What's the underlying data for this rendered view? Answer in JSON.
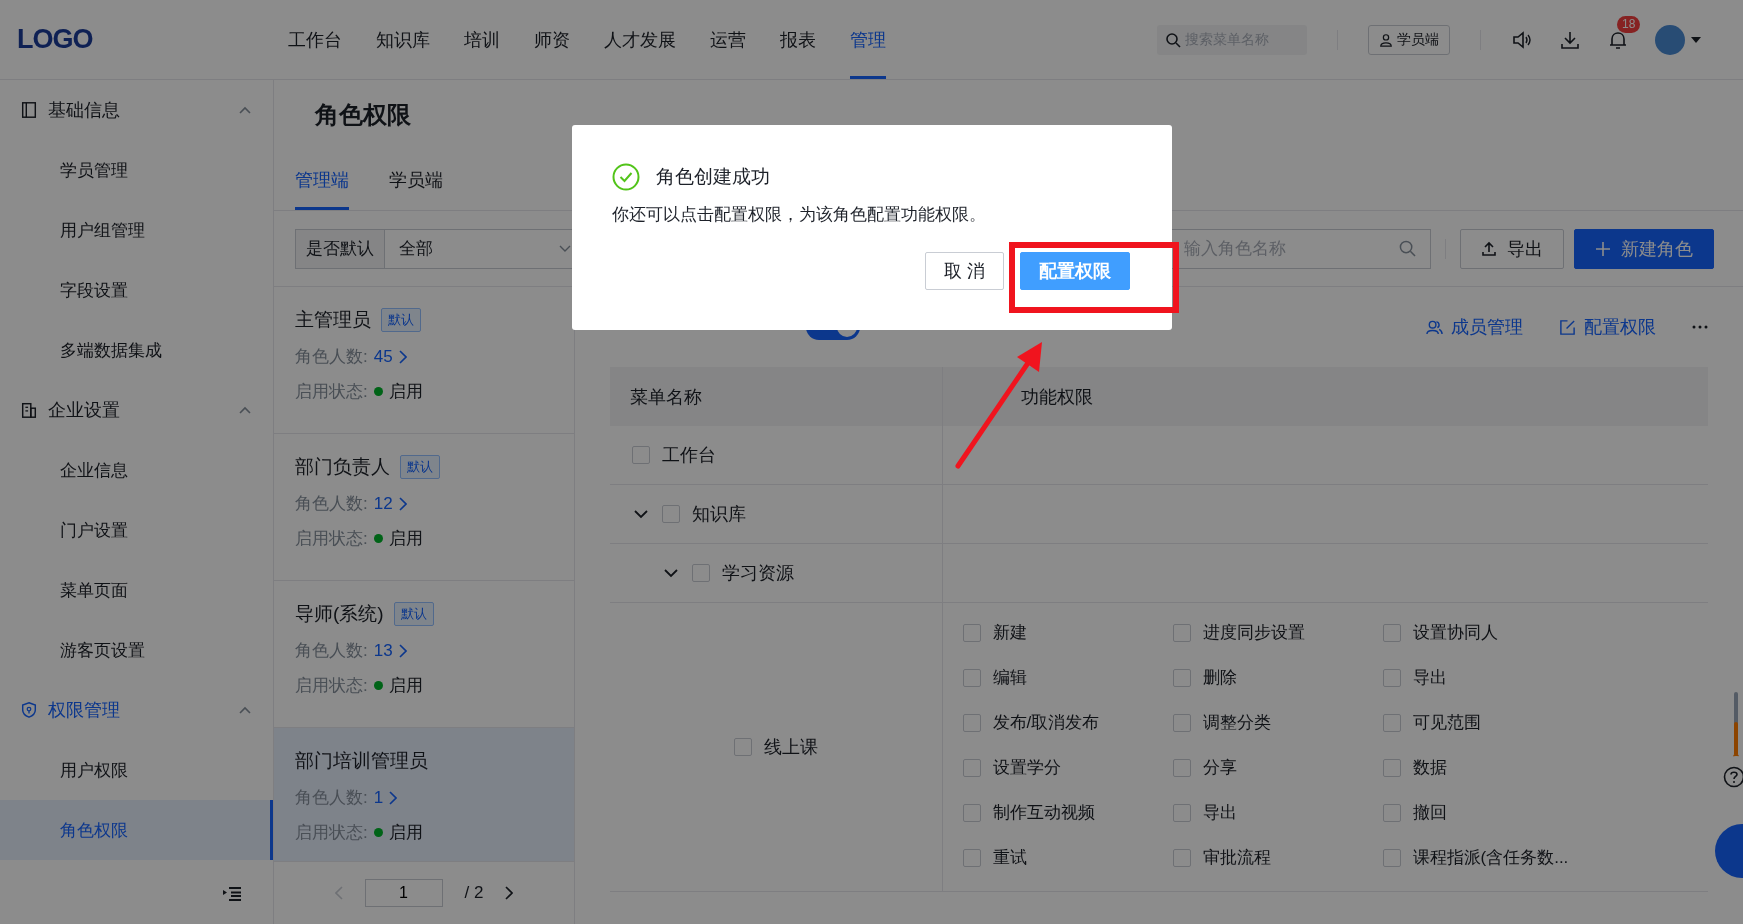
{
  "header": {
    "logo": "LOGO",
    "nav": [
      {
        "label": "工作台",
        "selected": false
      },
      {
        "label": "知识库",
        "selected": false
      },
      {
        "label": "培训",
        "selected": false
      },
      {
        "label": "师资",
        "selected": false
      },
      {
        "label": "人才发展",
        "selected": false
      },
      {
        "label": "运营",
        "selected": false
      },
      {
        "label": "报表",
        "selected": false
      },
      {
        "label": "管理",
        "selected": true
      }
    ],
    "search": {
      "placeholder": "搜索菜单名称"
    },
    "student_button": "学员端",
    "notification_count": "18"
  },
  "sidebar": {
    "groups": [
      {
        "title": "基础信息",
        "expanded": true,
        "selected": false,
        "items": [
          {
            "label": "学员管理",
            "selected": false
          },
          {
            "label": "用户组管理",
            "selected": false
          },
          {
            "label": "字段设置",
            "selected": false
          },
          {
            "label": "多端数据集成",
            "selected": false
          }
        ]
      },
      {
        "title": "企业设置",
        "expanded": true,
        "selected": false,
        "items": [
          {
            "label": "企业信息",
            "selected": false
          },
          {
            "label": "门户设置",
            "selected": false
          },
          {
            "label": "菜单页面",
            "selected": false
          },
          {
            "label": "游客页设置",
            "selected": false
          }
        ]
      },
      {
        "title": "权限管理",
        "expanded": true,
        "selected": true,
        "items": [
          {
            "label": "用户权限",
            "selected": false
          },
          {
            "label": "角色权限",
            "selected": true
          }
        ]
      }
    ]
  },
  "page": {
    "title": "角色权限",
    "tabs": [
      {
        "label": "管理端",
        "selected": true
      },
      {
        "label": "学员端",
        "selected": false
      }
    ],
    "filter": {
      "label": "是否默认",
      "value": "全部"
    },
    "search": {
      "placeholder": "输入角色名称"
    },
    "export_button": "导出",
    "create_button": "新建角色"
  },
  "roles": [
    {
      "name": "主管理员",
      "badge": "默认",
      "count_label": "角色人数:",
      "count": "45",
      "status_label": "启用状态:",
      "status": "启用",
      "selected": false
    },
    {
      "name": "部门负责人",
      "badge": "默认",
      "count_label": "角色人数:",
      "count": "12",
      "status_label": "启用状态:",
      "status": "启用",
      "selected": false
    },
    {
      "name": "导师(系统)",
      "badge": "默认",
      "count_label": "角色人数:",
      "count": "13",
      "status_label": "启用状态:",
      "status": "启用",
      "selected": false
    },
    {
      "name": "部门培训管理员",
      "count_label": "角色人数:",
      "count": "1",
      "status_label": "启用状态:",
      "status": "启用",
      "selected": true
    }
  ],
  "pagination": {
    "page": "1",
    "total": "/ 2"
  },
  "detail": {
    "enabled": true,
    "actions": [
      {
        "kind": "members",
        "label": "成员管理"
      },
      {
        "kind": "edit",
        "label": "配置权限"
      }
    ],
    "columns": [
      "菜单名称",
      "功能权限"
    ],
    "tree": [
      {
        "label": "工作台",
        "checked": false
      },
      {
        "label": "知识库",
        "checked": false,
        "expanded": true,
        "children": [
          {
            "label": "学习资源",
            "checked": false,
            "expanded": true,
            "children": [
              {
                "label": "线上课",
                "checked": false,
                "functions": [
                  {
                    "label": "新建",
                    "checked": false
                  },
                  {
                    "label": "进度同步设置",
                    "checked": false
                  },
                  {
                    "label": "设置协同人",
                    "checked": false
                  },
                  {
                    "label": "编辑",
                    "checked": false
                  },
                  {
                    "label": "删除",
                    "checked": false
                  },
                  {
                    "label": "导出",
                    "checked": false
                  },
                  {
                    "label": "发布/取消发布",
                    "checked": false
                  },
                  {
                    "label": "调整分类",
                    "checked": false
                  },
                  {
                    "label": "可见范围",
                    "checked": false
                  },
                  {
                    "label": "设置学分",
                    "checked": false
                  },
                  {
                    "label": "分享",
                    "checked": false
                  },
                  {
                    "label": "数据",
                    "checked": false
                  },
                  {
                    "label": "制作互动视频",
                    "checked": false
                  },
                  {
                    "label": "导出",
                    "checked": false
                  },
                  {
                    "label": "撤回",
                    "checked": false
                  },
                  {
                    "label": "重试",
                    "checked": false
                  },
                  {
                    "label": "审批流程",
                    "checked": false
                  },
                  {
                    "label": "课程指派(含任务数...",
                    "checked": false
                  }
                ]
              }
            ]
          }
        ]
      }
    ]
  },
  "modal": {
    "title": "角色创建成功",
    "message": "你还可以点击配置权限，为该角色配置功能权限。",
    "cancel_button": "取 消",
    "confirm_button": "配置权限"
  }
}
